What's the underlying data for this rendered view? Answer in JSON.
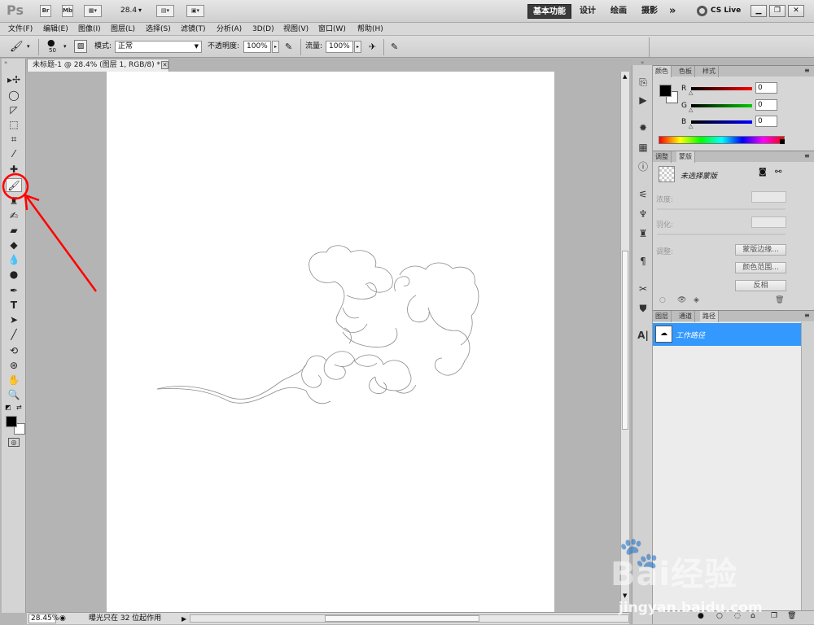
{
  "app": {
    "logo": "Ps",
    "zoom_display": "28.4",
    "workspaces": [
      "基本功能",
      "设计",
      "绘画",
      "摄影"
    ],
    "more": "»",
    "cslive": "CS Live"
  },
  "menus": [
    "文件(F)",
    "编辑(E)",
    "图像(I)",
    "图层(L)",
    "选择(S)",
    "滤镜(T)",
    "分析(A)",
    "3D(D)",
    "视图(V)",
    "窗口(W)",
    "帮助(H)"
  ],
  "options": {
    "brush_size": "50",
    "mode_label": "模式:",
    "mode_value": "正常",
    "opacity_label": "不透明度:",
    "opacity_value": "100%",
    "flow_label": "流量:",
    "flow_value": "100%"
  },
  "document": {
    "tab_title": "未标题-1 @ 28.4% (图层 1, RGB/8) *",
    "zoom_status": "28.45%",
    "status_text": "曝光只在 32 位起作用"
  },
  "color_panel": {
    "tabs": [
      "颜色",
      "色板",
      "样式"
    ],
    "channels": [
      {
        "label": "R",
        "value": "0",
        "color": "#d00000"
      },
      {
        "label": "G",
        "value": "0",
        "color": "#00b000"
      },
      {
        "label": "B",
        "value": "0",
        "color": "#0000d0"
      }
    ],
    "foreground": "#000000",
    "background": "#ffffff"
  },
  "masks_panel": {
    "tabs": [
      "调整",
      "蒙版"
    ],
    "no_mask": "未选择蒙版",
    "density": "浓度:",
    "feather": "羽化:",
    "adjust": "调整:",
    "buttons": [
      "蒙版边缘...",
      "颜色范围...",
      "反相"
    ]
  },
  "paths_panel": {
    "tabs": [
      "图层",
      "通道",
      "路径"
    ],
    "path_name": "工作路径"
  },
  "watermark": {
    "text": "Bai经验",
    "url": "jingyan.baidu.com"
  },
  "colors": {
    "selection": "#3399ff",
    "annotation": "#ff0000"
  }
}
